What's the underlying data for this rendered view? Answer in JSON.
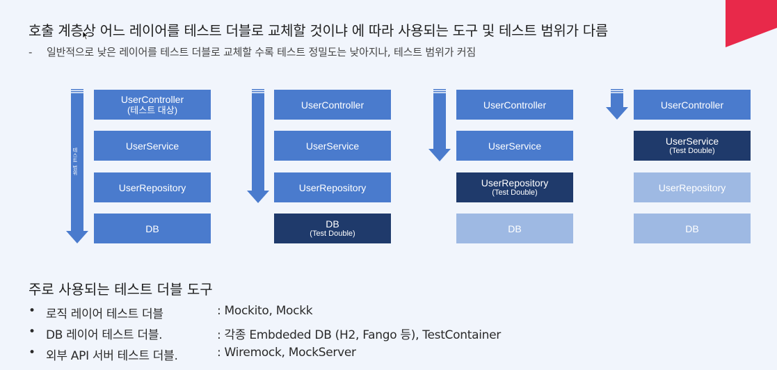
{
  "header": {
    "title": "호출 계층상 어느 레이어를 테스트 더블로 교체할 것이냐 에 따라 사용되는 도구 및 테스트 범위가 다름",
    "subtitle_dash": "-",
    "subtitle": "일반적으로 낮은 레이어를 테스트 더블로 교체할 수록 테스트 정밀도는 낮아지나, 테스트 범위가 커짐"
  },
  "colors": {
    "normal": "#4a7bcd",
    "dark": "#1f3a6b",
    "light": "#9eb9e3",
    "accent": "#e8294a"
  },
  "diagram": {
    "range_label": "테스트 범위",
    "columns": [
      {
        "layers": [
          {
            "name": "UserController",
            "note": "(테스트 대상)",
            "style": "normal"
          },
          {
            "name": "UserService",
            "note": "",
            "style": "normal"
          },
          {
            "name": "UserRepository",
            "note": "",
            "style": "normal"
          },
          {
            "name": "DB",
            "note": "",
            "style": "normal"
          }
        ]
      },
      {
        "layers": [
          {
            "name": "UserController",
            "note": "",
            "style": "normal"
          },
          {
            "name": "UserService",
            "note": "",
            "style": "normal"
          },
          {
            "name": "UserRepository",
            "note": "",
            "style": "normal"
          },
          {
            "name": "DB",
            "note": "(Test Double)",
            "style": "dark"
          }
        ]
      },
      {
        "layers": [
          {
            "name": "UserController",
            "note": "",
            "style": "normal"
          },
          {
            "name": "UserService",
            "note": "",
            "style": "normal"
          },
          {
            "name": "UserRepository",
            "note": "(Test Double)",
            "style": "dark"
          },
          {
            "name": "DB",
            "note": "",
            "style": "light"
          }
        ]
      },
      {
        "layers": [
          {
            "name": "UserController",
            "note": "",
            "style": "normal"
          },
          {
            "name": "UserService",
            "note": "(Test Double)",
            "style": "dark"
          },
          {
            "name": "UserRepository",
            "note": "",
            "style": "light"
          },
          {
            "name": "DB",
            "note": "",
            "style": "light"
          }
        ]
      }
    ]
  },
  "tools": {
    "title": "주로 사용되는 테스트 더블 도구",
    "items": [
      {
        "bullet": "•",
        "name": "로직 레이어 테스트 더블",
        "value": ": Mockito, Mockk"
      },
      {
        "bullet": "•",
        "name": "DB 레이어 테스트 더블.",
        "value": ": 각종 Embdeded DB (H2, Fango 등), TestContainer"
      },
      {
        "bullet": "•",
        "name": "외부 API 서버 테스트 더블.",
        "value": ": Wiremock, MockServer"
      }
    ]
  }
}
